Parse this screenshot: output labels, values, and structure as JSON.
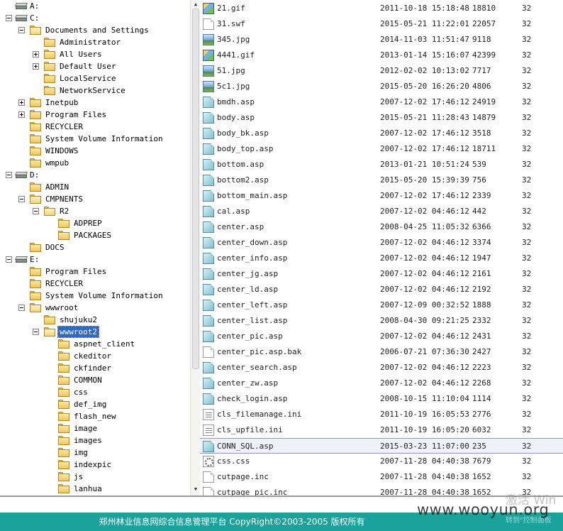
{
  "tree": [
    {
      "label": "A:",
      "type": "drive",
      "indent": 0,
      "expander": "none"
    },
    {
      "label": "C:",
      "type": "drive",
      "indent": 0,
      "expander": "minus"
    },
    {
      "label": "Documents and Settings",
      "type": "folder",
      "indent": 1,
      "expander": "minus"
    },
    {
      "label": "Administrator",
      "type": "folder",
      "indent": 2,
      "expander": "none"
    },
    {
      "label": "All Users",
      "type": "folder",
      "indent": 2,
      "expander": "plus"
    },
    {
      "label": "Default User",
      "type": "folder",
      "indent": 2,
      "expander": "plus"
    },
    {
      "label": "LocalService",
      "type": "folder",
      "indent": 2,
      "expander": "none"
    },
    {
      "label": "NetworkService",
      "type": "folder",
      "indent": 2,
      "expander": "none"
    },
    {
      "label": "Inetpub",
      "type": "folder",
      "indent": 1,
      "expander": "plus"
    },
    {
      "label": "Program Files",
      "type": "folder",
      "indent": 1,
      "expander": "plus"
    },
    {
      "label": "RECYCLER",
      "type": "folder",
      "indent": 1,
      "expander": "none"
    },
    {
      "label": "System Volume Information",
      "type": "folder",
      "indent": 1,
      "expander": "none"
    },
    {
      "label": "WINDOWS",
      "type": "folder",
      "indent": 1,
      "expander": "none"
    },
    {
      "label": "wmpub",
      "type": "folder",
      "indent": 1,
      "expander": "none"
    },
    {
      "label": "D:",
      "type": "drive",
      "indent": 0,
      "expander": "minus"
    },
    {
      "label": "ADMIN",
      "type": "folder",
      "indent": 1,
      "expander": "none"
    },
    {
      "label": "CMPNENTS",
      "type": "folder",
      "indent": 1,
      "expander": "minus"
    },
    {
      "label": "R2",
      "type": "folder",
      "indent": 2,
      "expander": "minus"
    },
    {
      "label": "ADPREP",
      "type": "folder",
      "indent": 3,
      "expander": "none"
    },
    {
      "label": "PACKAGES",
      "type": "folder",
      "indent": 3,
      "expander": "none"
    },
    {
      "label": "DOCS",
      "type": "folder",
      "indent": 1,
      "expander": "none"
    },
    {
      "label": "E:",
      "type": "drive",
      "indent": 0,
      "expander": "minus"
    },
    {
      "label": "Program Files",
      "type": "folder",
      "indent": 1,
      "expander": "none"
    },
    {
      "label": "RECYCLER",
      "type": "folder",
      "indent": 1,
      "expander": "none"
    },
    {
      "label": "System Volume Information",
      "type": "folder",
      "indent": 1,
      "expander": "none"
    },
    {
      "label": "wwwroot",
      "type": "folder",
      "indent": 1,
      "expander": "minus"
    },
    {
      "label": "shujuku2",
      "type": "folder",
      "indent": 2,
      "expander": "none"
    },
    {
      "label": "wwwroot2",
      "type": "folder",
      "indent": 2,
      "expander": "minus",
      "selected": true
    },
    {
      "label": "aspnet_client",
      "type": "folder",
      "indent": 3,
      "expander": "none"
    },
    {
      "label": "ckeditor",
      "type": "folder",
      "indent": 3,
      "expander": "none"
    },
    {
      "label": "ckfinder",
      "type": "folder",
      "indent": 3,
      "expander": "none"
    },
    {
      "label": "COMMON",
      "type": "folder",
      "indent": 3,
      "expander": "none"
    },
    {
      "label": "css",
      "type": "folder",
      "indent": 3,
      "expander": "none"
    },
    {
      "label": "def_img",
      "type": "folder",
      "indent": 3,
      "expander": "none"
    },
    {
      "label": "flash_new",
      "type": "folder",
      "indent": 3,
      "expander": "none"
    },
    {
      "label": "image",
      "type": "folder",
      "indent": 3,
      "expander": "none"
    },
    {
      "label": "images",
      "type": "folder",
      "indent": 3,
      "expander": "none"
    },
    {
      "label": "img",
      "type": "folder",
      "indent": 3,
      "expander": "none"
    },
    {
      "label": "indexpic",
      "type": "folder",
      "indent": 3,
      "expander": "none"
    },
    {
      "label": "js",
      "type": "folder",
      "indent": 3,
      "expander": "none"
    },
    {
      "label": "lanhua",
      "type": "folder",
      "indent": 3,
      "expander": "none"
    }
  ],
  "files": [
    {
      "name": "21.gif",
      "date": "2011-10-18 15:18:48",
      "size": "18810",
      "attr": "32",
      "icon": "gif"
    },
    {
      "name": "31.swf",
      "date": "2015-05-21 11:22:01",
      "size": "22057",
      "attr": "32",
      "icon": "doc"
    },
    {
      "name": "345.jpg",
      "date": "2014-11-03 11:51:47",
      "size": "9118",
      "attr": "32",
      "icon": "image"
    },
    {
      "name": "4441.gif",
      "date": "2013-01-14 15:16:07",
      "size": "42399",
      "attr": "32",
      "icon": "gif"
    },
    {
      "name": "51.jpg",
      "date": "2012-02-02 10:13:02",
      "size": "7717",
      "attr": "32",
      "icon": "image"
    },
    {
      "name": "5c1.jpg",
      "date": "2015-05-20 16:26:20",
      "size": "4806",
      "attr": "32",
      "icon": "image"
    },
    {
      "name": "bmdh.asp",
      "date": "2007-12-02 17:46:12",
      "size": "24919",
      "attr": "32",
      "icon": "asp"
    },
    {
      "name": "body.asp",
      "date": "2015-05-21 11:28:43",
      "size": "14879",
      "attr": "32",
      "icon": "asp"
    },
    {
      "name": "body_bk.asp",
      "date": "2007-12-02 17:46:12",
      "size": "3518",
      "attr": "32",
      "icon": "asp"
    },
    {
      "name": "body_top.asp",
      "date": "2007-12-02 17:46:12",
      "size": "18711",
      "attr": "32",
      "icon": "asp"
    },
    {
      "name": "bottom.asp",
      "date": "2013-01-21 10:51:24",
      "size": "539",
      "attr": "32",
      "icon": "asp"
    },
    {
      "name": "bottom2.asp",
      "date": "2015-05-20 15:39:39",
      "size": "756",
      "attr": "32",
      "icon": "asp"
    },
    {
      "name": "bottom_main.asp",
      "date": "2007-12-02 17:46:12",
      "size": "2339",
      "attr": "32",
      "icon": "asp"
    },
    {
      "name": "cal.asp",
      "date": "2007-12-02 04:46:12",
      "size": "442",
      "attr": "32",
      "icon": "asp"
    },
    {
      "name": "center.asp",
      "date": "2008-04-25 11:05:32",
      "size": "6366",
      "attr": "32",
      "icon": "asp"
    },
    {
      "name": "center_down.asp",
      "date": "2007-12-02 04:46:12",
      "size": "3374",
      "attr": "32",
      "icon": "asp"
    },
    {
      "name": "center_info.asp",
      "date": "2007-12-02 04:46:12",
      "size": "1947",
      "attr": "32",
      "icon": "asp"
    },
    {
      "name": "center_jg.asp",
      "date": "2007-12-02 04:46:12",
      "size": "2161",
      "attr": "32",
      "icon": "asp"
    },
    {
      "name": "center_ld.asp",
      "date": "2007-12-02 04:46:12",
      "size": "2192",
      "attr": "32",
      "icon": "asp"
    },
    {
      "name": "center_left.asp",
      "date": "2007-12-09 00:32:52",
      "size": "1888",
      "attr": "32",
      "icon": "asp"
    },
    {
      "name": "center_list.asp",
      "date": "2008-04-30 09:21:25",
      "size": "2332",
      "attr": "32",
      "icon": "asp"
    },
    {
      "name": "center_pic.asp",
      "date": "2007-12-02 04:46:12",
      "size": "2431",
      "attr": "32",
      "icon": "asp"
    },
    {
      "name": "center_pic.asp.bak",
      "date": "2006-07-21 07:36:30",
      "size": "2427",
      "attr": "32",
      "icon": "doc"
    },
    {
      "name": "center_search.asp",
      "date": "2007-12-02 04:46:12",
      "size": "2223",
      "attr": "32",
      "icon": "asp"
    },
    {
      "name": "center_zw.asp",
      "date": "2007-12-02 04:46:12",
      "size": "2268",
      "attr": "32",
      "icon": "asp"
    },
    {
      "name": "check_login.asp",
      "date": "2008-10-15 11:10:04",
      "size": "1114",
      "attr": "32",
      "icon": "asp"
    },
    {
      "name": "cls_filemanage.ini",
      "date": "2011-10-19 16:05:53",
      "size": "2776",
      "attr": "32",
      "icon": "ini"
    },
    {
      "name": "cls_upfile.ini",
      "date": "2011-10-19 16:05:20",
      "size": "6032",
      "attr": "32",
      "icon": "ini"
    },
    {
      "name": "CONN_SQL.asp",
      "date": "2015-03-23 11:07:00",
      "size": "235",
      "attr": "32",
      "icon": "asp",
      "selected": true
    },
    {
      "name": "css.css",
      "date": "2007-11-28 04:40:38",
      "size": "7679",
      "attr": "32",
      "icon": "css"
    },
    {
      "name": "cutpage.inc",
      "date": "2007-11-28 04:40:38",
      "size": "1652",
      "attr": "32",
      "icon": "doc"
    },
    {
      "name": "cutpage_pic.inc",
      "date": "2007-11-28 04:40:38",
      "size": "1652",
      "attr": "32",
      "icon": "doc"
    }
  ],
  "footer": {
    "text": "郑州林业信息网综合信息管理平台 CopyRight©2003-2005 版权所有"
  },
  "watermarks": {
    "activate": "激活 Win",
    "activate_sub": "转到\"控制面板",
    "site": "www.wooyun.org"
  },
  "colors": {
    "selection": "#3169c6",
    "footer_bg": "#1aa39b",
    "row_highlight": "#eef0fb"
  }
}
